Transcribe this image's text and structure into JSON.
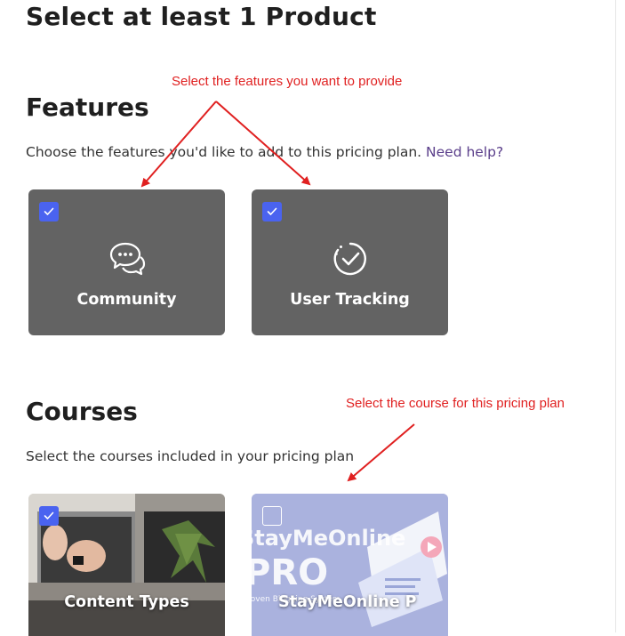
{
  "page": {
    "title": "Select at least 1 Product"
  },
  "features": {
    "title": "Features",
    "description": "Choose the features you'd like to add to this pricing plan.",
    "help_link": "Need help?",
    "items": [
      {
        "label": "Community",
        "icon": "chat-bubbles-icon",
        "checked": true
      },
      {
        "label": "User Tracking",
        "icon": "check-circle-icon",
        "checked": true
      }
    ]
  },
  "courses": {
    "title": "Courses",
    "description": "Select the courses included in your pricing plan",
    "items": [
      {
        "label": "Content Types",
        "checked": true
      },
      {
        "label": "StayMeOnline P",
        "checked": false,
        "thumbnail_title": "StayMeOnline",
        "thumbnail_badge": "PRO",
        "thumbnail_caption": "Proven Blogging System"
      }
    ]
  },
  "annotations": {
    "features": "Select the features you want to provide",
    "courses": "Select the course for this pricing plan"
  },
  "colors": {
    "card_bg": "#636363",
    "checkbox_on": "#4a63f0",
    "annotation": "#e02020",
    "link": "#5a3e8a",
    "course2_bg": "#a9b1dd"
  }
}
